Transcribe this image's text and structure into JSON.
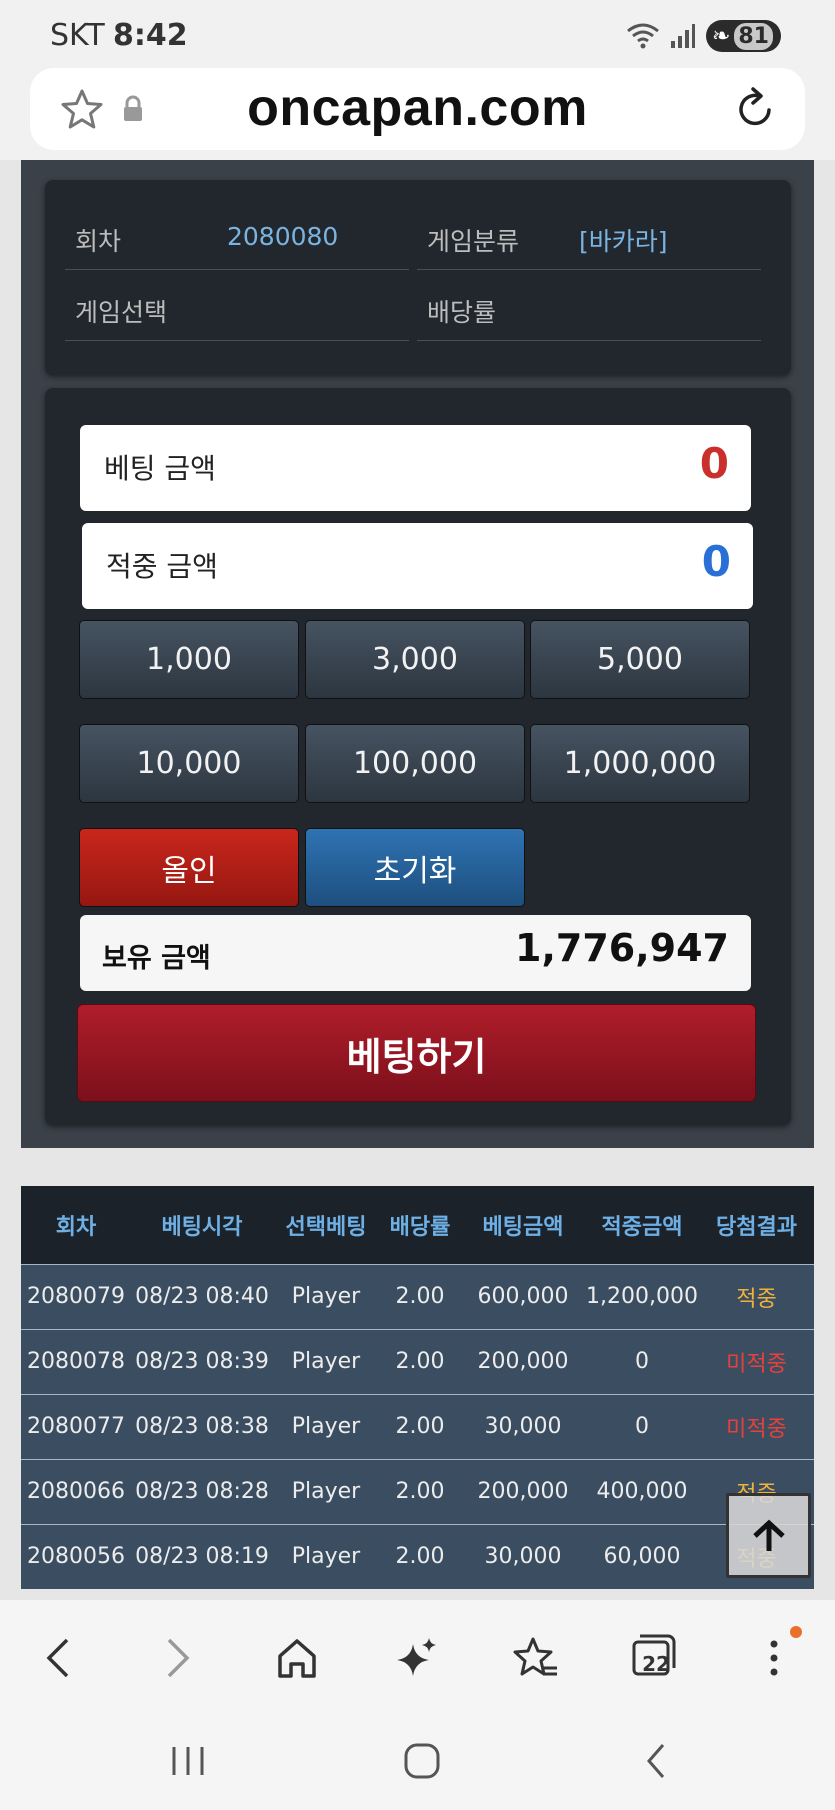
{
  "status_bar": {
    "carrier": "SKT",
    "time": "8:42",
    "battery": "81"
  },
  "browser": {
    "url": "oncapan.com",
    "tab_count": "22"
  },
  "info": {
    "round_label": "회차",
    "round_value": "2080080",
    "category_label": "게임분류",
    "category_value": "[바카라]",
    "game_select_label": "게임선택",
    "game_select_value": "",
    "odds_label": "배당률",
    "odds_value": ""
  },
  "betting": {
    "bet_amount_label": "베팅 금액",
    "bet_amount_value": "0",
    "bet_amount_color": "#c9302c",
    "win_amount_label": "적중 금액",
    "win_amount_value": "0",
    "win_amount_color": "#2a6fd6",
    "chips": [
      "1,000",
      "3,000",
      "5,000",
      "10,000",
      "100,000",
      "1,000,000"
    ],
    "allin_label": "올인",
    "reset_label": "초기화",
    "balance_label": "보유 금액",
    "balance_value": "1,776,947",
    "submit_label": "베팅하기"
  },
  "history": {
    "headers": [
      "회차",
      "베팅시각",
      "선택베팅",
      "배당률",
      "베팅금액",
      "적중금액",
      "당첨결과"
    ],
    "rows": [
      [
        "2080079",
        "08/23 08:40",
        "Player",
        "2.00",
        "600,000",
        "1,200,000",
        "적중"
      ],
      [
        "2080078",
        "08/23 08:39",
        "Player",
        "2.00",
        "200,000",
        "0",
        "미적중"
      ],
      [
        "2080077",
        "08/23 08:38",
        "Player",
        "2.00",
        "30,000",
        "0",
        "미적중"
      ],
      [
        "2080066",
        "08/23 08:28",
        "Player",
        "2.00",
        "200,000",
        "400,000",
        "적중"
      ],
      [
        "2080056",
        "08/23 08:19",
        "Player",
        "2.00",
        "30,000",
        "60,000",
        "적중"
      ]
    ],
    "hit_color": "#f0b23c",
    "miss_color": "#e8403c"
  },
  "icons": {
    "toolbar": [
      "back-icon",
      "forward-icon",
      "home-icon",
      "sparkle-icon",
      "bookmarks-icon",
      "tabs-icon",
      "more-icon"
    ],
    "nav": [
      "recent-apps-icon",
      "home-nav-icon",
      "back-nav-icon"
    ]
  }
}
